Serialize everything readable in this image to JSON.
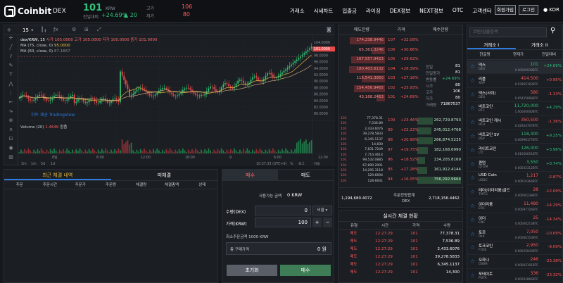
{
  "header": {
    "logo": "Coinbit",
    "pair": "DEX",
    "price": "101",
    "price_unit": "KRW",
    "change_label": "전일대비",
    "change_pct": "+24.69%",
    "change_abs": "▲ 20",
    "high_label": "고가",
    "high": "106",
    "low_label": "저가",
    "low": "80",
    "nav": [
      "거래소",
      "시세차트",
      "입출금",
      "라이징",
      "DEX정보",
      "NEXT정보",
      "OTC",
      "고객센터"
    ],
    "signup": "회원가입",
    "login": "로그인",
    "lang": "KOR"
  },
  "chart": {
    "interval": "15",
    "title": "dex/KRW, 15",
    "ohlc": "시가 105.0000  고가 105.0000  저가 100.0000  종가 101.0000",
    "ma1": "MA (75, close, 0)",
    "ma1v": "95.0000",
    "ma2": "MA (60, close, 0)",
    "ma2v": "87.1667",
    "volume": "Volume (20)",
    "vol_val": "1.464K",
    "vol_extra": "합품",
    "prices": [
      "104.0000",
      "101.0000",
      "98.0000",
      "96.0000",
      "94.0000",
      "92.0000",
      "90.0000",
      "88.0000",
      "86.0000",
      "84.0000",
      "82.0000",
      "80.0000"
    ],
    "times": [
      "8일",
      "6:00",
      "12:00",
      "18:00",
      "9",
      "6:00",
      "12:00"
    ],
    "watermark": "차트 제공 TradingView",
    "ranges": [
      "3m",
      "1m",
      "5d",
      "1d"
    ],
    "clock": "10:37:33 (UTC+9)",
    "scale": "%",
    "log": "로그",
    "auto": "자동"
  },
  "trades": {
    "tabs": [
      "최근 체결 내역",
      "미체결"
    ],
    "cols": [
      "주문",
      "주문시간",
      "주문가",
      "주문량",
      "체결량",
      "체결총액",
      "상태"
    ]
  },
  "order": {
    "tabs": [
      "매수",
      "매도"
    ],
    "avail_label": "사용가능 금액",
    "avail": "0 KRW",
    "qty_label": "수량(DEX)",
    "qty": "0",
    "qty_opt": "비율",
    "price_label": "가격(KRW)",
    "price": "100",
    "min_label": "최소주문금액 1000 KRW",
    "total_label": "총 구매가격",
    "total": "0 원",
    "reset": "초기화",
    "buy": "매수"
  },
  "orderbook": {
    "cols": [
      "매도잔량",
      "가격",
      "매수잔량"
    ],
    "asks": [
      [
        "174,238.9446",
        "107",
        "+32.09%"
      ],
      [
        "65,361.3246",
        "106",
        "+30.86%"
      ],
      [
        "167,557.9423",
        "105",
        "+29.62%"
      ],
      [
        "180,403.6132",
        "104",
        "+28.39%"
      ],
      [
        "115,541.3950",
        "103",
        "+27.16%"
      ],
      [
        "154,456.9465",
        "102",
        "+25.93%"
      ],
      [
        "43,168.2463",
        "101",
        "+24.69%"
      ]
    ],
    "info": [
      [
        "전일",
        "81"
      ],
      [
        "전일종가",
        "81"
      ],
      [
        "변동률",
        "+24.69%"
      ],
      [
        "시가",
        "80"
      ],
      [
        "고가",
        "106"
      ],
      [
        "저가",
        "80"
      ],
      [
        "거래량",
        "71867537"
      ]
    ],
    "bids": [
      [
        "100",
        "+23.46%",
        "262,729.8793"
      ],
      [
        "99",
        "+22.22%",
        "245,012.4768"
      ],
      [
        "98",
        "+20.99%",
        "266,874.5235"
      ],
      [
        "97",
        "+19.75%",
        "182,168.6990"
      ],
      [
        "96",
        "+18.52%",
        "134,205.8169"
      ],
      [
        "95",
        "+17.28%",
        "161,912.4144"
      ],
      [
        "94",
        "+16.05%",
        "756,292.9664"
      ]
    ],
    "left_fills": [
      [
        "101",
        "77,378.31"
      ],
      [
        "101",
        "7,536.89"
      ],
      [
        "101",
        "2,433.6076"
      ],
      [
        "101",
        "39,278.5833"
      ],
      [
        "101",
        "6,345.1137"
      ],
      [
        "101",
        "14,600"
      ],
      [
        "101",
        "7,831.7249"
      ],
      [
        "101",
        "7,714.4614"
      ],
      [
        "101",
        "99,532.0885"
      ],
      [
        "101",
        "67,890.2001"
      ],
      [
        "101",
        "14,295.3118"
      ],
      [
        "101",
        "129.6694"
      ],
      [
        "101",
        "128.6641"
      ]
    ],
    "sum_ask": "1,194,680.4072",
    "sum_label": "주문잔량합계",
    "sum_unit": "DEX",
    "sum_bid": "2,718,156.4462"
  },
  "realtime": {
    "title": "실시간 체결 현황",
    "cols": [
      "유형",
      "시간",
      "가격",
      "수량"
    ],
    "rows": [
      [
        "매도",
        "12:27:29",
        "101",
        "77,378.31"
      ],
      [
        "매도",
        "12:27:29",
        "101",
        "7,536.89"
      ],
      [
        "매도",
        "12:27:29",
        "101",
        "2,433.6076"
      ],
      [
        "매도",
        "12:27:29",
        "101",
        "39,278.5833"
      ],
      [
        "매도",
        "12:27:29",
        "101",
        "6,345.1137"
      ],
      [
        "매도",
        "12:27:29",
        "101",
        "14,300"
      ]
    ]
  },
  "coins": {
    "search_placeholder": "코인/심볼검색",
    "tabs": [
      "거래소 I",
      "거래소 II"
    ],
    "cols": [
      "한글명",
      "현재가",
      "전일대비"
    ],
    "items": [
      [
        "덱스",
        "DEX",
        "101",
        "0.00000938BTC",
        "+24.69%",
        "green"
      ],
      [
        "리플",
        "XRP",
        "414.500",
        "0.03965183BTC",
        "+0.95%",
        "red"
      ],
      [
        "덱스(사이)",
        "DEX",
        "580",
        "0.05425068BTC",
        "-1.13%",
        "red"
      ],
      [
        "비트코인",
        "BTC",
        "11,720,000",
        "1.00000000BTC",
        "+4.29%",
        "green"
      ],
      [
        "비트코인 캐시",
        "BCH",
        "350,500",
        "0.02924707BTC",
        "-1.36%",
        "red"
      ],
      [
        "비트코인 SV",
        "BSV",
        "118,300",
        "0.00998177BTC",
        "+9.25%",
        "green"
      ],
      [
        "라이트코인",
        "LTC",
        "126,000",
        "0.01056051BTC",
        "+3.96%",
        "green"
      ],
      [
        "퀀텀",
        "QTUM",
        "3,550",
        "0.00032312BTC",
        "+0.74%",
        "green"
      ],
      [
        "USD Coin",
        "USDC",
        "1,217",
        "0.00010364BTC",
        "-2.87%",
        "red"
      ],
      [
        "테더(이더리움)골드",
        "TMTG",
        "28",
        "0.00000238BTC",
        "-12.09%",
        "red"
      ],
      [
        "이더리움",
        "ERC",
        "11,480",
        "0.00097726BTC",
        "-14.29%",
        "red"
      ],
      [
        "이더",
        "ENC",
        "25",
        "0.00000213BTC",
        "-14.34%",
        "red"
      ],
      [
        "토르",
        "PAX",
        "7,050",
        "0.00060153BTC",
        "-10.09%",
        "red"
      ],
      [
        "토크코인",
        "FOXE",
        "2,950",
        "0.00025043BTC",
        "-9.09%",
        "red"
      ],
      [
        "오하나",
        "OSNA",
        "246",
        "0.00002101BTC",
        "-23.38%",
        "red"
      ],
      [
        "포테이토",
        "POTA",
        "336",
        "0.00002866BTC",
        "-23.32%",
        "red"
      ]
    ]
  }
}
